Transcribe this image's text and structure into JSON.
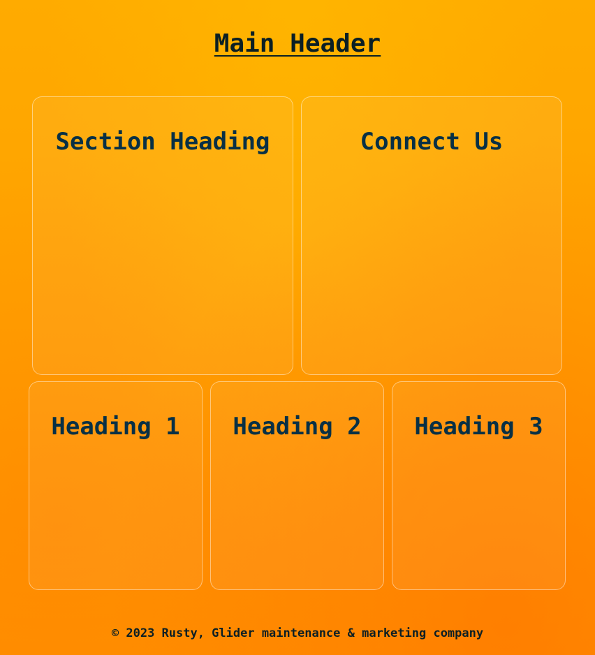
{
  "header": {
    "title": "Main Header"
  },
  "top_sections": [
    {
      "heading": "Section Heading"
    },
    {
      "heading": "Connect Us"
    }
  ],
  "bottom_sections": [
    {
      "heading": "Heading 1"
    },
    {
      "heading": "Heading 2"
    },
    {
      "heading": "Heading 3"
    }
  ],
  "footer": {
    "text": "© 2023 Rusty, Glider maintenance & marketing company"
  },
  "colors": {
    "background": "#ffa000",
    "heading": "#083045",
    "text": "#0b1f24"
  }
}
